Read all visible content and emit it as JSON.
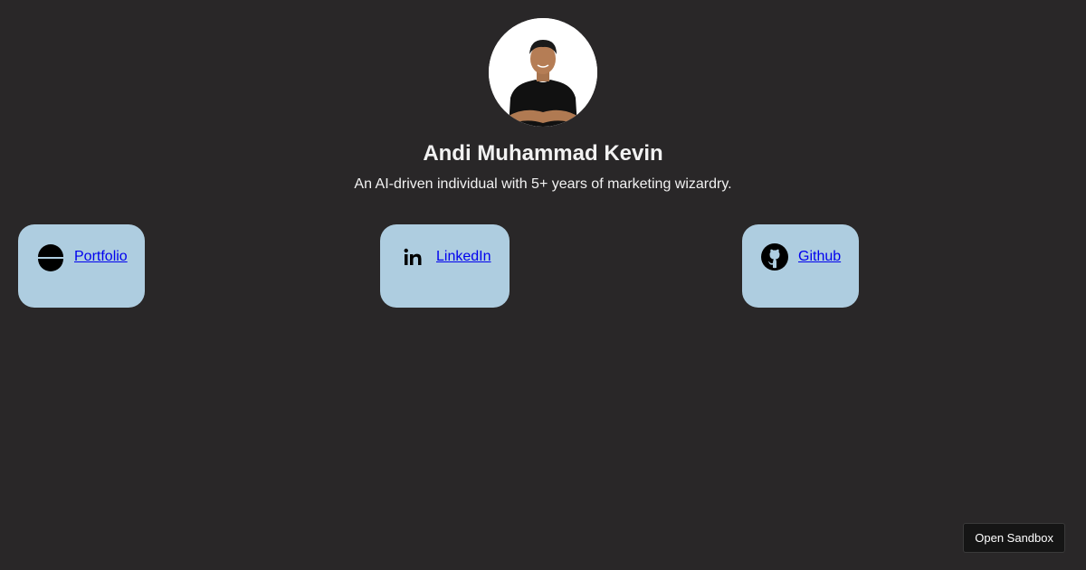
{
  "profile": {
    "name": "Andi Muhammad Kevin",
    "tagline": "An AI-driven individual with 5+ years of marketing wizardry."
  },
  "links": [
    {
      "label": "Portfolio",
      "icon": "briefcase-icon"
    },
    {
      "label": "LinkedIn",
      "icon": "linkedin-icon"
    },
    {
      "label": "Github",
      "icon": "github-icon"
    }
  ],
  "footer": {
    "sandbox_label": "Open Sandbox"
  },
  "colors": {
    "background": "#292728",
    "card": "#aecde0",
    "link": "#0000ee",
    "text": "#f2f2f2",
    "button": "#151515"
  }
}
